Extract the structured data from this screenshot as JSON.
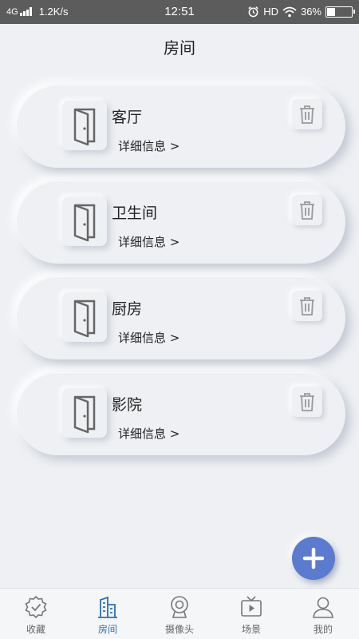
{
  "status_bar": {
    "network": "4G",
    "speed": "1.2K/s",
    "time": "12:51",
    "hd": "HD",
    "battery": "36%",
    "battery_level": 0.36
  },
  "header": {
    "title": "房间"
  },
  "rooms": [
    {
      "name": "客厅",
      "detail": "详细信息 >"
    },
    {
      "name": "卫生间",
      "detail": "详细信息 >"
    },
    {
      "name": "厨房",
      "detail": "详细信息 >"
    },
    {
      "name": "影院",
      "detail": "详细信息 >"
    }
  ],
  "fab": {
    "icon": "plus-icon"
  },
  "bottom_nav": {
    "items": [
      {
        "label": "收藏",
        "icon": "favorite-icon"
      },
      {
        "label": "房间",
        "icon": "building-icon",
        "active": true
      },
      {
        "label": "摄像头",
        "icon": "camera-icon"
      },
      {
        "label": "场景",
        "icon": "tv-scene-icon"
      },
      {
        "label": "我的",
        "icon": "user-icon"
      }
    ]
  },
  "colors": {
    "accent": "#2b6fb8",
    "fab": "#5b7bd0",
    "background": "#eef0f3",
    "status_bar": "#5c5c5c"
  }
}
